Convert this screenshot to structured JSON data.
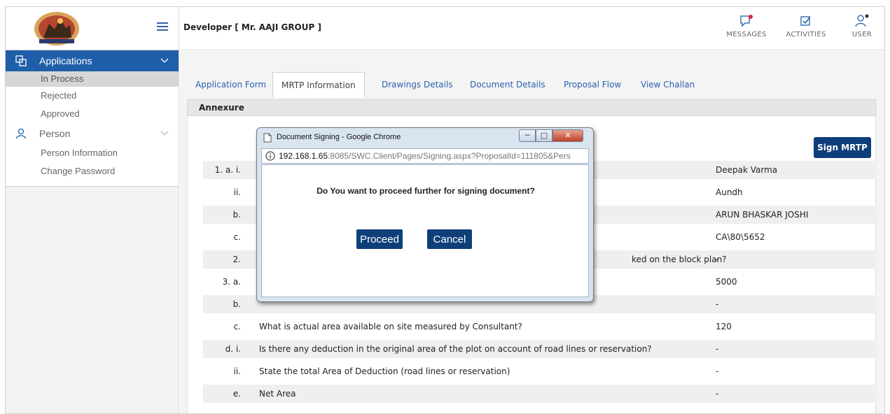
{
  "header": {
    "developer_title": "Developer [ Mr. AAJI GROUP ]",
    "messages_label": "MESSAGES",
    "activities_label": "ACTIVITIES",
    "user_label": "USER"
  },
  "sidebar": {
    "applications": {
      "label": "Applications",
      "items": [
        "In Process",
        "Rejected",
        "Approved"
      ]
    },
    "person": {
      "label": "Person",
      "items": [
        "Person Information",
        "Change Password"
      ]
    }
  },
  "tabs": [
    "Application Form",
    "MRTP Information",
    "Drawings Details",
    "Document Details",
    "Proposal Flow",
    "View Challan"
  ],
  "active_tab": "MRTP Information",
  "annexure_title": "Annexure",
  "sign_button": "Sign MRTP",
  "rows": [
    {
      "num": "1.  a.  i.",
      "question": "",
      "value": "Deepak Varma"
    },
    {
      "num": "ii.",
      "question": "",
      "value": "Aundh"
    },
    {
      "num": "b.",
      "question": "",
      "value": "ARUN BHASKAR JOSHI"
    },
    {
      "num": "c.",
      "question": "",
      "value": "CA\\80\\5652"
    },
    {
      "num": "2.",
      "question": "ked on the block plan?",
      "value": "-"
    },
    {
      "num": "3.  a.",
      "question": "",
      "value": "5000"
    },
    {
      "num": "b.",
      "question": "",
      "value": "-"
    },
    {
      "num": "c.",
      "question": "What is actual area available on site measured by Consultant?",
      "value": "120"
    },
    {
      "num": "d.  i.",
      "question": "Is there any deduction in the original area of the plot on account of road lines or reservation?",
      "value": "-"
    },
    {
      "num": "ii.",
      "question": "State the total Area of Deduction (road lines or reservation)",
      "value": "-"
    },
    {
      "num": "e.",
      "question": "Net Area",
      "value": "-"
    }
  ],
  "popup": {
    "window_title": "Document Signing - Google Chrome",
    "address_host": "192.168.1.65",
    "address_rest": ":8085/SWC.Client/Pages/Signing.aspx?ProposalId=111805&Pers",
    "question": "Do You want to proceed further for signing document?",
    "proceed_label": "Proceed",
    "cancel_label": "Cancel"
  },
  "colors": {
    "primary": "#1f5fa9",
    "button_dark": "#0f3f79",
    "notify_dot": "#d9233a"
  }
}
